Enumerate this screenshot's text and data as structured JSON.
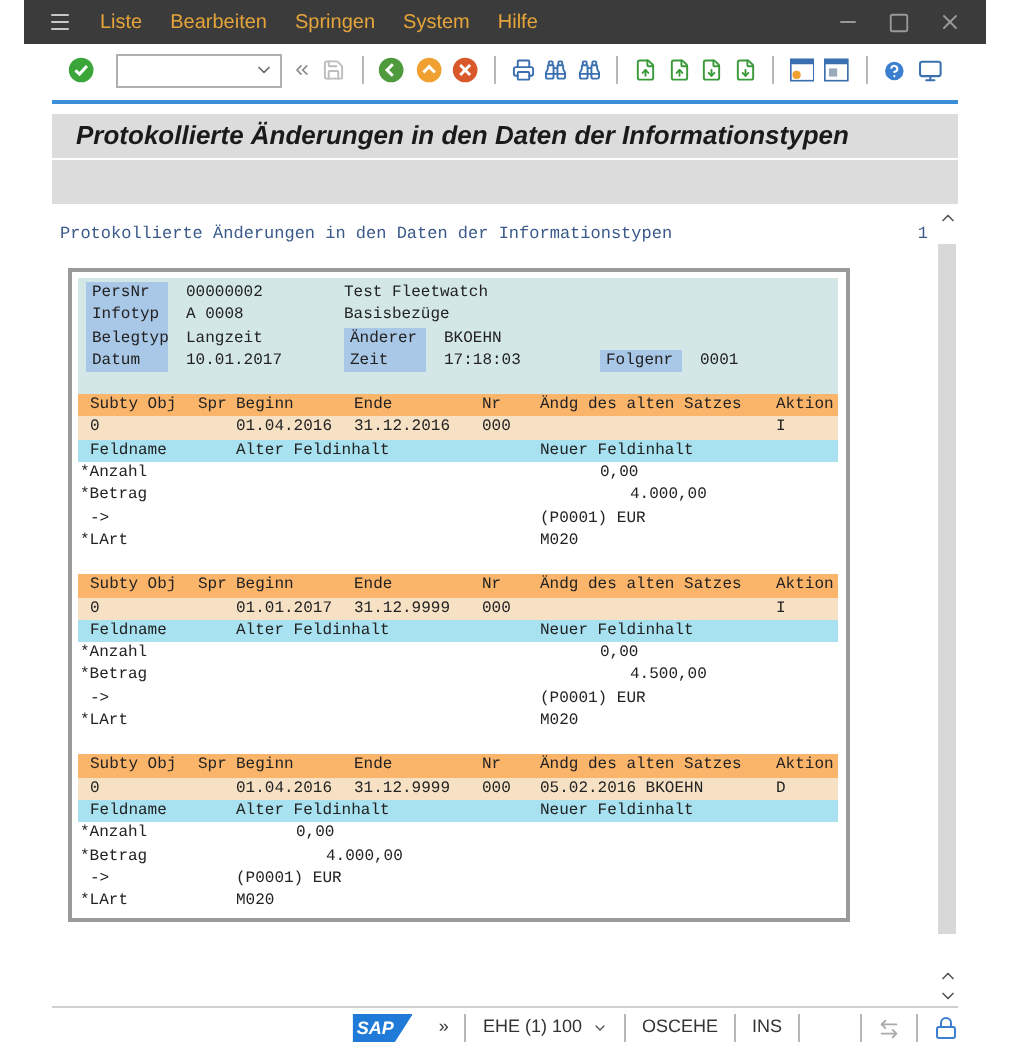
{
  "menu_bar": {
    "items": [
      "Liste",
      "Bearbeiten",
      "Springen",
      "System",
      "Hilfe"
    ]
  },
  "title": "Protokollierte Änderungen in den Daten der Informationstypen",
  "list_header": {
    "title": "Protokollierte Änderungen in den Daten der Informationstypen",
    "page": "1"
  },
  "info": [
    {
      "cells": [
        {
          "label": "PersNr",
          "value": "00000002"
        },
        {
          "value": "Test Fleetwatch"
        }
      ]
    },
    {
      "cells": [
        {
          "label": "Infotyp",
          "value": "A 0008"
        },
        {
          "value": "Basisbezüge"
        }
      ]
    },
    {
      "cells": [
        {
          "label": "Belegtyp",
          "value": "Langzeit"
        },
        {
          "label": "Änderer",
          "value": "BKOEHN"
        }
      ]
    },
    {
      "cells": [
        {
          "label": "Datum",
          "value": "10.01.2017"
        },
        {
          "label": "Zeit",
          "value": "17:18:03"
        },
        {
          "label": "Folgenr",
          "value": "0001"
        }
      ]
    }
  ],
  "changes": [
    {
      "columns": [
        "Subty Obj",
        "Spr",
        "Beginn",
        "Ende",
        "Nr",
        "Ändg des alten Satzes",
        "Aktion"
      ],
      "values": {
        "subty_obj": "0",
        "beginn": "01.04.2016",
        "ende": "31.12.2016",
        "nr": "000",
        "aktion": "I"
      },
      "field_columns": [
        "Feldname",
        "Alter Feldinhalt",
        "Neuer Feldinhalt"
      ],
      "fields": [
        {
          "name": "*Anzahl",
          "kind": "count",
          "new": "0,00"
        },
        {
          "name": "*Betrag",
          "kind": "amount",
          "new": "4.000,00"
        },
        {
          "name": "->",
          "kind": "text",
          "new": "(P0001) EUR"
        },
        {
          "name": "*LArt",
          "kind": "text",
          "new": "M020"
        }
      ]
    },
    {
      "columns": [
        "Subty Obj",
        "Spr",
        "Beginn",
        "Ende",
        "Nr",
        "Ändg des alten Satzes",
        "Aktion"
      ],
      "values": {
        "subty_obj": "0",
        "beginn": "01.01.2017",
        "ende": "31.12.9999",
        "nr": "000",
        "aktion": "I"
      },
      "field_columns": [
        "Feldname",
        "Alter Feldinhalt",
        "Neuer Feldinhalt"
      ],
      "fields": [
        {
          "name": "*Anzahl",
          "kind": "count",
          "new": "0,00"
        },
        {
          "name": "*Betrag",
          "kind": "amount",
          "new": "4.500,00"
        },
        {
          "name": "->",
          "kind": "text",
          "new": "(P0001) EUR"
        },
        {
          "name": "*LArt",
          "kind": "text",
          "new": "M020"
        }
      ]
    },
    {
      "columns": [
        "Subty Obj",
        "Spr",
        "Beginn",
        "Ende",
        "Nr",
        "Ändg des alten Satzes",
        "Aktion"
      ],
      "values": {
        "subty_obj": "0",
        "beginn": "01.04.2016",
        "ende": "31.12.9999",
        "nr": "000",
        "aendg": "05.02.2016 BKOEHN",
        "aktion": "D"
      },
      "field_columns": [
        "Feldname",
        "Alter Feldinhalt",
        "Neuer Feldinhalt"
      ],
      "fields": [
        {
          "name": "*Anzahl",
          "kind": "count",
          "old": "0,00"
        },
        {
          "name": "*Betrag",
          "kind": "amount",
          "old": "4.000,00"
        },
        {
          "name": "->",
          "kind": "text",
          "old": "(P0001) EUR"
        },
        {
          "name": "*LArt",
          "kind": "text",
          "old": "M020"
        }
      ]
    }
  ],
  "status_bar": {
    "logo": "SAP",
    "more": "»",
    "session": "EHE (1) 100",
    "user": "OSCEHE",
    "mode": "INS"
  }
}
